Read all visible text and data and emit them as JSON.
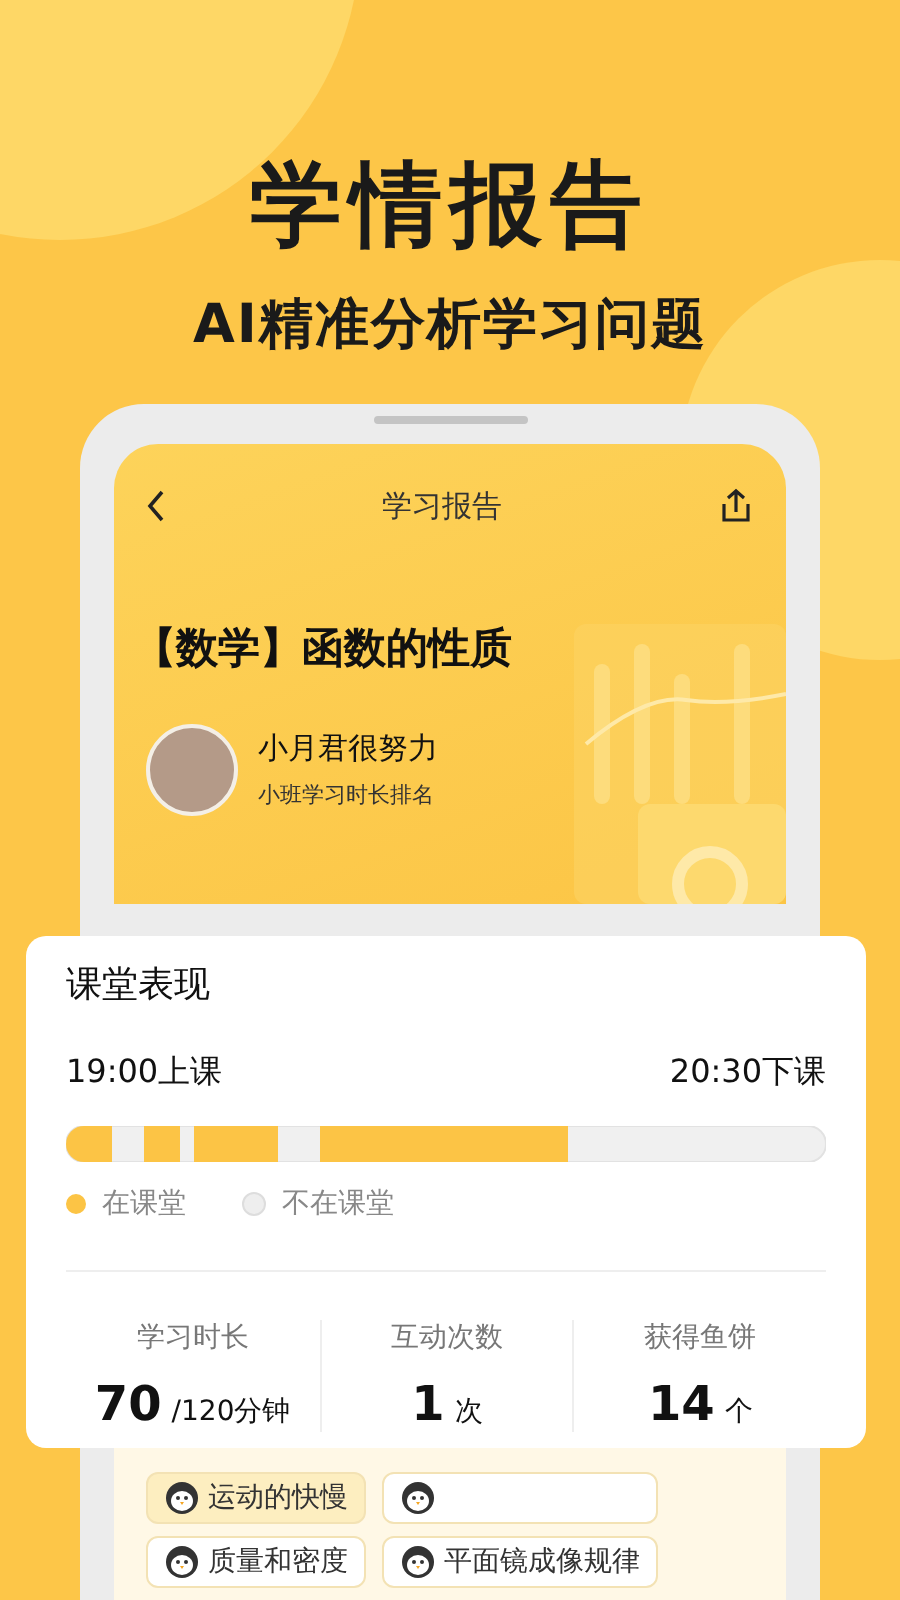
{
  "headline": "学情报告",
  "subheadline": "AI精准分析学习问题",
  "screen": {
    "nav_title": "学习报告",
    "report_title": "【数学】函数的性质",
    "user_name": "小月君很努力",
    "user_caption": "小班学习时长排名"
  },
  "performance": {
    "title": "课堂表现",
    "start": "19:00上课",
    "end": "20:30下课",
    "legend": [
      {
        "kind": "present",
        "label": "在课堂"
      },
      {
        "kind": "absent",
        "label": "不在课堂"
      }
    ],
    "stats": [
      {
        "label": "学习时长",
        "value": "70",
        "unit": "/120分钟"
      },
      {
        "label": "互动次数",
        "value": "1",
        "unit": "次"
      },
      {
        "label": "获得鱼饼",
        "value": "14",
        "unit": "个"
      }
    ]
  },
  "topics": [
    {
      "label": "运动的快慢",
      "selected": true
    },
    {
      "selected": false
    },
    {
      "label": "质量和密度",
      "selected": false
    },
    {
      "label": "平面镜成像规律",
      "selected": false
    }
  ]
}
